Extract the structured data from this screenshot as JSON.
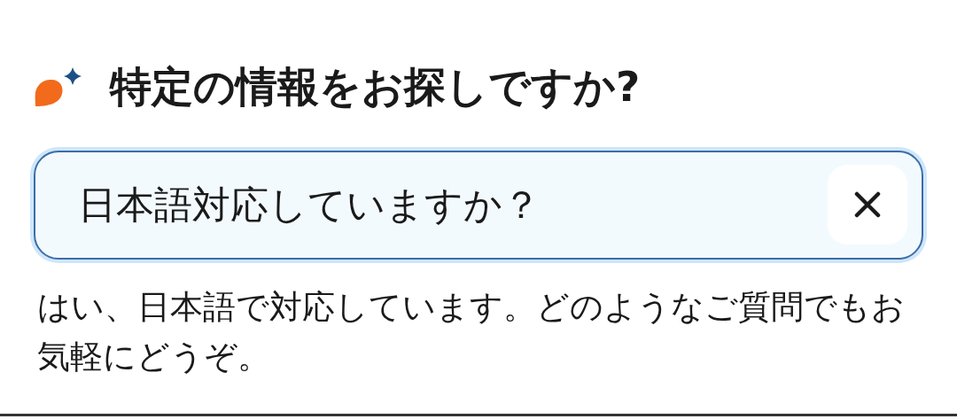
{
  "heading": "特定の情報をお探しですか?",
  "search": {
    "value": "日本語対応していますか？"
  },
  "answer": "はい、日本語で対応しています。どのようなご質問でもお気軽にどうぞ。"
}
